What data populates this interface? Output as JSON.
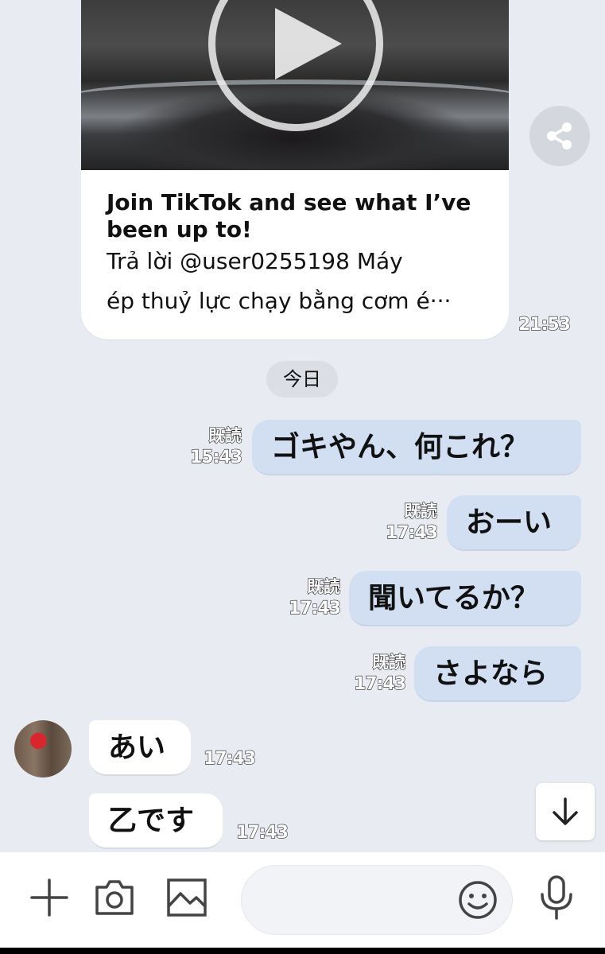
{
  "link_card": {
    "title": "Join TikTok and see what I’ve been up to!",
    "description_line1": "Trả lời @user0255198 Máy",
    "description_line2": "ép thuỷ lực chạy bằng cơm é···",
    "time": "21:53"
  },
  "date_separator": "今日",
  "outgoing_messages": [
    {
      "text": "ゴキやん、何これ？",
      "read": "既読",
      "time": "15:43"
    },
    {
      "text": "おーい",
      "read": "既読",
      "time": "17:43"
    },
    {
      "text": "聞いてるか？",
      "read": "既読",
      "time": "17:43"
    },
    {
      "text": "さよなら",
      "read": "既読",
      "time": "17:43"
    }
  ],
  "incoming_messages": [
    {
      "text": "あい",
      "time": "17:43"
    },
    {
      "text": "乙です",
      "time": "17:43"
    }
  ],
  "input_bar": {
    "placeholder": "",
    "icons": [
      "plus-icon",
      "camera-icon",
      "image-icon",
      "emoji-icon",
      "microphone-icon"
    ]
  },
  "colors": {
    "background": "#e9ebf2",
    "outgoing_bubble": "#d2dff3",
    "incoming_bubble": "#ffffff"
  }
}
